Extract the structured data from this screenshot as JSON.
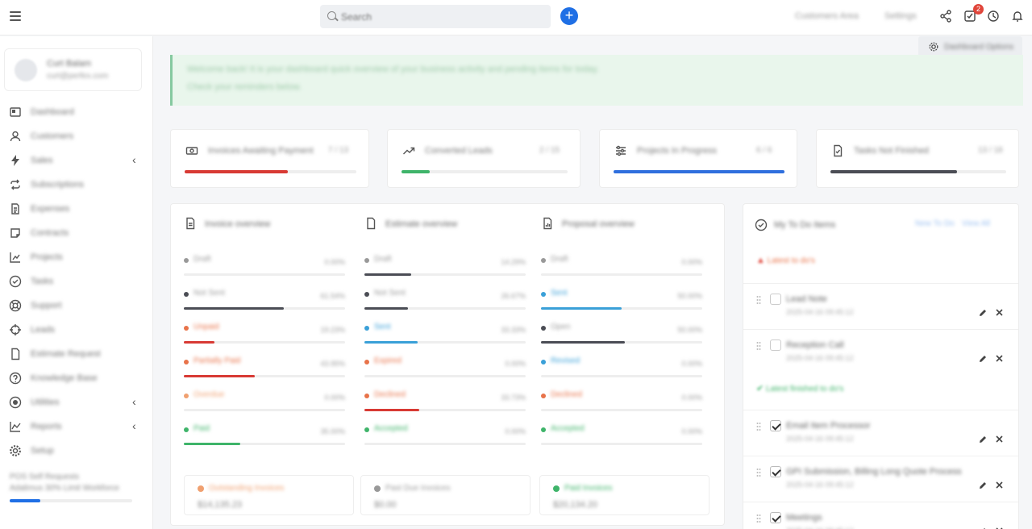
{
  "topbar": {
    "search_placeholder": "Search",
    "link_customers_area": "Customers Area",
    "link_settings": "Settings",
    "notification_count": "2"
  },
  "sidebar": {
    "profile": {
      "name": "Curt Balam",
      "email": "curt@perfex.com"
    },
    "items": [
      {
        "label": "Dashboard",
        "icon": "dashboard-icon",
        "chevron": false
      },
      {
        "label": "Customers",
        "icon": "user-icon",
        "chevron": false
      },
      {
        "label": "Sales",
        "icon": "bolt-icon",
        "chevron": true
      },
      {
        "label": "Subscriptions",
        "icon": "repeat-icon",
        "chevron": false
      },
      {
        "label": "Expenses",
        "icon": "file-text-icon",
        "chevron": false
      },
      {
        "label": "Contracts",
        "icon": "note-icon",
        "chevron": false
      },
      {
        "label": "Projects",
        "icon": "chart-bars-icon",
        "chevron": false
      },
      {
        "label": "Tasks",
        "icon": "check-circle-icon",
        "chevron": false
      },
      {
        "label": "Support",
        "icon": "lifebuoy-icon",
        "chevron": false
      },
      {
        "label": "Leads",
        "icon": "crosshair-icon",
        "chevron": false
      },
      {
        "label": "Estimate Request",
        "icon": "document-icon",
        "chevron": false
      },
      {
        "label": "Knowledge Base",
        "icon": "question-circle-icon",
        "chevron": false
      },
      {
        "label": "Utilities",
        "icon": "record-icon",
        "chevron": true
      },
      {
        "label": "Reports",
        "icon": "line-chart-icon",
        "chevron": true
      },
      {
        "label": "Setup",
        "icon": "gear-icon",
        "chevron": false
      }
    ],
    "footer_line1": "POS Self Requests",
    "footer_line2": "Adalimus 30% Limit Workforce",
    "footer_progress": 0.25
  },
  "dashboard_options": "Dashboard Options",
  "banner": {
    "line1": "Welcome back! It is your dashboard quick overview of your business activity and pending items for today.",
    "line2": "Check your reminders below."
  },
  "stats": [
    {
      "label": "Invoices Awaiting Payment",
      "value": "7 / 13",
      "icon": "money-icon",
      "progress": 0.6,
      "color": "#d83a34"
    },
    {
      "label": "Converted Leads",
      "value": "2 / 15",
      "icon": "trend-icon",
      "progress": 0.17,
      "color": "#3fb46a"
    },
    {
      "label": "Projects In Progress",
      "value": "6 / 6",
      "icon": "sliders-icon",
      "progress": 1.0,
      "color": "#2f6fde"
    },
    {
      "label": "Tasks Not Finished",
      "value": "13 / 18",
      "icon": "file-check-icon",
      "progress": 0.72,
      "color": "#4b4d55"
    }
  ],
  "overview": [
    {
      "title": "Invoice overview",
      "icon": "invoice-icon",
      "rows": [
        {
          "name": "Draft",
          "pct": "0.00%",
          "color": "#999",
          "progress": 0
        },
        {
          "name": "Not Sent",
          "pct": "61.54%",
          "color": "#4b4d55",
          "progress": 0.62
        },
        {
          "name": "Unpaid",
          "pct": "19.23%",
          "color": "#e8734a",
          "progress": 0.19
        },
        {
          "name": "Partially Paid",
          "pct": "43.95%",
          "color": "#e8734a",
          "progress": 0.44
        },
        {
          "name": "Overdue",
          "pct": "0.00%",
          "color": "#f0a070",
          "progress": 0
        },
        {
          "name": "Paid",
          "pct": "35.00%",
          "color": "#3fb46a",
          "progress": 0.35
        }
      ],
      "bar_colors": [
        "#999",
        "#4b4d55",
        "#d83a34",
        "#d83a34",
        "#f0a070",
        "#3fb46a"
      ]
    },
    {
      "title": "Estimate overview",
      "icon": "estimate-icon",
      "rows": [
        {
          "name": "Draft",
          "pct": "14.29%",
          "color": "#999",
          "progress": 0.29
        },
        {
          "name": "Not Sent",
          "pct": "26.67%",
          "color": "#4b4d55",
          "progress": 0.27
        },
        {
          "name": "Sent",
          "pct": "33.33%",
          "color": "#3aa0d8",
          "progress": 0.33
        },
        {
          "name": "Expired",
          "pct": "0.00%",
          "color": "#e8734a",
          "progress": 0
        },
        {
          "name": "Declined",
          "pct": "33.73%",
          "color": "#e8734a",
          "progress": 0.34
        },
        {
          "name": "Accepted",
          "pct": "0.00%",
          "color": "#3fb46a",
          "progress": 0
        }
      ],
      "bar_colors": [
        "#4b4d55",
        "#4b4d55",
        "#3aa0d8",
        "#e8734a",
        "#d83a34",
        "#3fb46a"
      ]
    },
    {
      "title": "Proposal overview",
      "icon": "proposal-icon",
      "rows": [
        {
          "name": "Draft",
          "pct": "0.00%",
          "color": "#999",
          "progress": 0
        },
        {
          "name": "Sent",
          "pct": "50.00%",
          "color": "#3aa0d8",
          "progress": 0.5
        },
        {
          "name": "Open",
          "pct": "50.00%",
          "color": "#4b4d55",
          "progress": 0.52
        },
        {
          "name": "Revised",
          "pct": "0.00%",
          "color": "#3aa0d8",
          "progress": 0
        },
        {
          "name": "Declined",
          "pct": "0.00%",
          "color": "#e8734a",
          "progress": 0
        },
        {
          "name": "Accepted",
          "pct": "0.00%",
          "color": "#3fb46a",
          "progress": 0
        }
      ],
      "bar_colors": [
        "#999",
        "#3aa0d8",
        "#4b4d55",
        "#3aa0d8",
        "#e8734a",
        "#3fb46a"
      ]
    }
  ],
  "summary": [
    {
      "name": "Outstanding Invoices",
      "value": "$14,135.23",
      "color": "#f0a070"
    },
    {
      "name": "Past Due Invoices",
      "value": "$0.00",
      "color": "#999"
    },
    {
      "name": "Paid Invoices",
      "value": "$20,134.20",
      "color": "#3fb46a"
    }
  ],
  "todo": {
    "title": "My To Do Items",
    "btn_new": "New To Do",
    "btn_view": "View All",
    "latest_label": "Latest to do's",
    "finished_label": "Latest finished to do's",
    "unfinished": [
      {
        "name": "Lead Note",
        "sub": "2025-04-16 09:45:12"
      },
      {
        "name": "Reception Call",
        "sub": "2025-04-16 09:45:12"
      }
    ],
    "finished": [
      {
        "name": "Email Item Processor",
        "sub": "2025-04-16 09:45:12"
      },
      {
        "name": "GPI Submission, Billing Long Quote Process",
        "sub": "2025-04-16 09:45:12"
      },
      {
        "name": "Meetings",
        "sub": "2025-04-16 09:45:12"
      }
    ]
  }
}
